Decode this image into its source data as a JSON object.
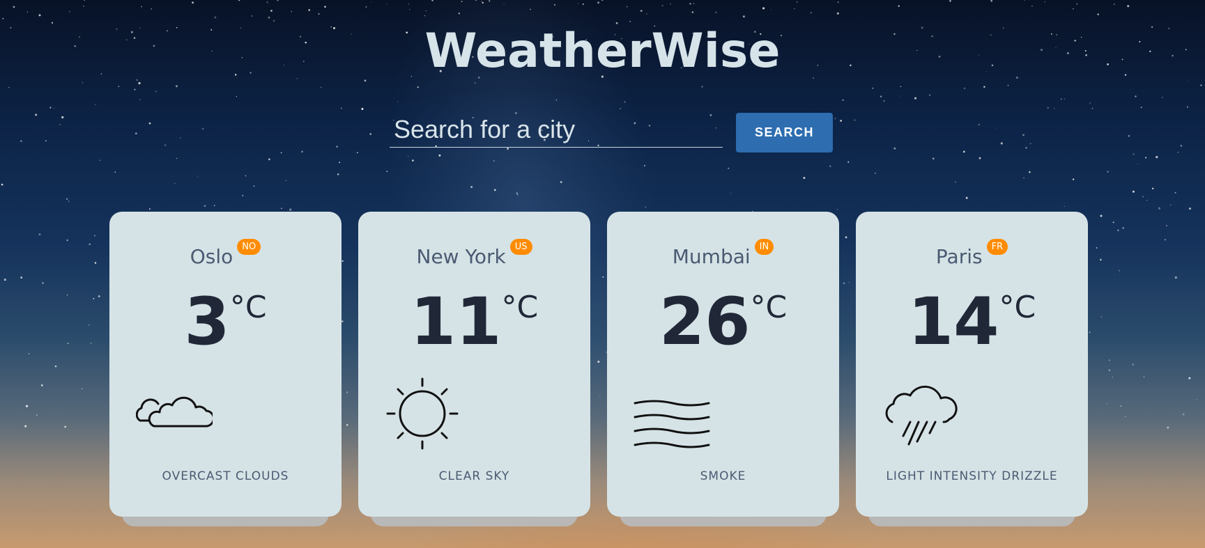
{
  "app": {
    "title": "WeatherWise"
  },
  "search": {
    "placeholder": "Search for a city",
    "button_label": "SEARCH"
  },
  "cards": [
    {
      "city": "Oslo",
      "country": "NO",
      "temp": "3",
      "unit": "°C",
      "icon": "clouds-icon",
      "description": "OVERCAST CLOUDS"
    },
    {
      "city": "New York",
      "country": "US",
      "temp": "11",
      "unit": "°C",
      "icon": "sun-icon",
      "description": "CLEAR SKY"
    },
    {
      "city": "Mumbai",
      "country": "IN",
      "temp": "26",
      "unit": "°C",
      "icon": "smoke-icon",
      "description": "SMOKE"
    },
    {
      "city": "Paris",
      "country": "FR",
      "temp": "14",
      "unit": "°C",
      "icon": "rain-cloud-icon",
      "description": "LIGHT INTENSITY DRIZZLE"
    }
  ],
  "colors": {
    "accent_button": "#2d6db0",
    "country_badge": "#ff8c00",
    "card_bg": "#d6e3e6"
  }
}
